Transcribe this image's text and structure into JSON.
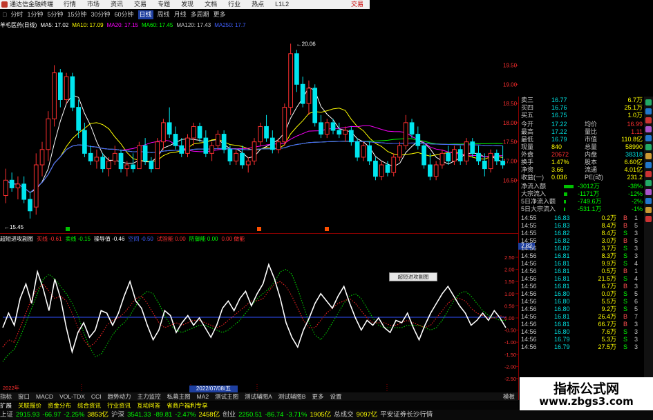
{
  "titlebar": {
    "title": "通达信金融终端",
    "menu": [
      "行情",
      "市场",
      "资讯",
      "交易",
      "专题",
      "发现",
      "文档",
      "行业",
      "热点",
      "L1L2"
    ],
    "trade_label": "交易",
    "colors": {
      "red": "#c00000"
    }
  },
  "period_bar": {
    "lead": "□",
    "items": [
      "分时",
      "1分钟",
      "5分钟",
      "15分钟",
      "30分钟",
      "60分钟",
      "日线",
      "周线",
      "月线",
      "多周期",
      "更多"
    ],
    "active_index": 6
  },
  "main_chart": {
    "stock": "羊毛医药(日线)",
    "ma": [
      {
        "label": "MA5: 17.02",
        "color": "#ffffff"
      },
      {
        "label": "MA10: 17.09",
        "color": "#ffff00"
      },
      {
        "label": "MA20: 17.15",
        "color": "#ff00ff"
      },
      {
        "label": "MA60: 17.45",
        "color": "#00ff00"
      },
      {
        "label": "MA120: 17.43",
        "color": "#c8c8c8"
      },
      {
        "label": "MA250: 17.7",
        "color": "#4060ff"
      }
    ],
    "high_label": "20.06",
    "low_label": "15.45",
    "price_axis": [
      "19.50",
      "19.00",
      "18.50",
      "18.00",
      "17.50",
      "17.00",
      "16.50"
    ],
    "candles": [
      {
        "o": 16.1,
        "h": 16.8,
        "l": 15.9,
        "c": 16.5
      },
      {
        "o": 16.5,
        "h": 16.7,
        "l": 16.2,
        "c": 16.3
      },
      {
        "o": 16.3,
        "h": 16.6,
        "l": 16.0,
        "c": 16.4
      },
      {
        "o": 16.4,
        "h": 16.6,
        "l": 15.9,
        "c": 16.0
      },
      {
        "o": 16.0,
        "h": 16.2,
        "l": 15.5,
        "c": 15.7
      },
      {
        "o": 15.8,
        "h": 17.2,
        "l": 15.6,
        "c": 16.9
      },
      {
        "o": 16.9,
        "h": 17.5,
        "l": 16.6,
        "c": 17.3
      },
      {
        "o": 17.3,
        "h": 18.3,
        "l": 17.0,
        "c": 18.1
      },
      {
        "o": 18.1,
        "h": 19.5,
        "l": 17.9,
        "c": 19.3
      },
      {
        "o": 19.3,
        "h": 19.4,
        "l": 18.4,
        "c": 18.6
      },
      {
        "o": 18.6,
        "h": 19.3,
        "l": 18.5,
        "c": 19.2
      },
      {
        "o": 19.2,
        "h": 19.3,
        "l": 18.3,
        "c": 18.4
      },
      {
        "o": 18.4,
        "h": 18.6,
        "l": 17.6,
        "c": 17.8
      },
      {
        "o": 17.8,
        "h": 18.0,
        "l": 17.1,
        "c": 17.2
      },
      {
        "o": 17.2,
        "h": 17.4,
        "l": 16.9,
        "c": 17.0
      },
      {
        "o": 17.0,
        "h": 17.3,
        "l": 16.8,
        "c": 17.1
      },
      {
        "o": 17.1,
        "h": 17.2,
        "l": 16.7,
        "c": 16.8
      },
      {
        "o": 16.8,
        "h": 17.1,
        "l": 16.6,
        "c": 17.0
      },
      {
        "o": 17.0,
        "h": 17.4,
        "l": 16.9,
        "c": 17.2
      },
      {
        "o": 17.2,
        "h": 17.3,
        "l": 16.7,
        "c": 16.8
      },
      {
        "o": 16.8,
        "h": 17.0,
        "l": 16.6,
        "c": 16.9
      },
      {
        "o": 16.9,
        "h": 17.2,
        "l": 16.7,
        "c": 16.8
      },
      {
        "o": 16.8,
        "h": 17.5,
        "l": 16.8,
        "c": 17.4
      },
      {
        "o": 17.4,
        "h": 17.6,
        "l": 16.9,
        "c": 17.0
      },
      {
        "o": 17.0,
        "h": 17.1,
        "l": 16.7,
        "c": 16.8
      },
      {
        "o": 16.8,
        "h": 17.6,
        "l": 16.8,
        "c": 17.5
      },
      {
        "o": 17.5,
        "h": 18.1,
        "l": 17.3,
        "c": 18.0
      },
      {
        "o": 18.0,
        "h": 18.4,
        "l": 17.6,
        "c": 17.7
      },
      {
        "o": 17.7,
        "h": 17.9,
        "l": 17.3,
        "c": 17.4
      },
      {
        "o": 17.4,
        "h": 17.6,
        "l": 17.1,
        "c": 17.2
      },
      {
        "o": 17.2,
        "h": 17.7,
        "l": 17.1,
        "c": 17.6
      },
      {
        "o": 17.6,
        "h": 18.0,
        "l": 17.4,
        "c": 17.9
      },
      {
        "o": 17.9,
        "h": 18.0,
        "l": 17.5,
        "c": 17.6
      },
      {
        "o": 17.6,
        "h": 17.8,
        "l": 17.1,
        "c": 17.2
      },
      {
        "o": 17.2,
        "h": 17.5,
        "l": 17.0,
        "c": 17.4
      },
      {
        "o": 17.4,
        "h": 17.8,
        "l": 17.3,
        "c": 17.7
      },
      {
        "o": 17.7,
        "h": 17.8,
        "l": 17.2,
        "c": 17.3
      },
      {
        "o": 17.3,
        "h": 17.4,
        "l": 16.9,
        "c": 17.0
      },
      {
        "o": 17.0,
        "h": 17.3,
        "l": 16.9,
        "c": 17.2
      },
      {
        "o": 17.2,
        "h": 17.4,
        "l": 16.8,
        "c": 16.9
      },
      {
        "o": 16.9,
        "h": 17.1,
        "l": 16.7,
        "c": 17.0
      },
      {
        "o": 17.0,
        "h": 17.6,
        "l": 16.9,
        "c": 17.5
      },
      {
        "o": 17.5,
        "h": 18.0,
        "l": 17.4,
        "c": 17.9
      },
      {
        "o": 17.9,
        "h": 18.2,
        "l": 17.5,
        "c": 17.6
      },
      {
        "o": 17.6,
        "h": 17.8,
        "l": 17.2,
        "c": 17.3
      },
      {
        "o": 17.3,
        "h": 17.6,
        "l": 17.2,
        "c": 17.5
      },
      {
        "o": 17.5,
        "h": 18.5,
        "l": 17.4,
        "c": 18.4
      },
      {
        "o": 18.4,
        "h": 20.06,
        "l": 18.2,
        "c": 19.8
      },
      {
        "o": 19.8,
        "h": 19.9,
        "l": 18.8,
        "c": 19.0
      },
      {
        "o": 19.0,
        "h": 19.2,
        "l": 18.4,
        "c": 18.5
      },
      {
        "o": 18.5,
        "h": 19.1,
        "l": 18.2,
        "c": 18.9
      },
      {
        "o": 18.9,
        "h": 19.0,
        "l": 17.9,
        "c": 18.0
      },
      {
        "o": 18.0,
        "h": 18.2,
        "l": 17.6,
        "c": 17.7
      },
      {
        "o": 17.7,
        "h": 18.1,
        "l": 17.6,
        "c": 18.0
      },
      {
        "o": 18.0,
        "h": 18.1,
        "l": 17.7,
        "c": 17.8
      },
      {
        "o": 17.8,
        "h": 18.0,
        "l": 17.6,
        "c": 17.7
      },
      {
        "o": 17.7,
        "h": 17.9,
        "l": 17.5,
        "c": 17.8
      },
      {
        "o": 17.8,
        "h": 17.9,
        "l": 17.4,
        "c": 17.5
      },
      {
        "o": 17.5,
        "h": 17.6,
        "l": 17.0,
        "c": 17.1
      },
      {
        "o": 17.1,
        "h": 17.5,
        "l": 17.0,
        "c": 17.4
      },
      {
        "o": 17.4,
        "h": 17.5,
        "l": 16.9,
        "c": 17.0
      },
      {
        "o": 17.0,
        "h": 17.1,
        "l": 16.5,
        "c": 16.6
      },
      {
        "o": 16.6,
        "h": 17.0,
        "l": 16.5,
        "c": 16.9
      },
      {
        "o": 16.9,
        "h": 17.0,
        "l": 16.6,
        "c": 16.7
      },
      {
        "o": 16.7,
        "h": 17.2,
        "l": 16.6,
        "c": 17.1
      },
      {
        "o": 17.1,
        "h": 17.5,
        "l": 17.0,
        "c": 17.4
      },
      {
        "o": 17.4,
        "h": 18.2,
        "l": 17.3,
        "c": 18.0
      },
      {
        "o": 18.0,
        "h": 18.1,
        "l": 17.6,
        "c": 17.7
      },
      {
        "o": 17.7,
        "h": 17.9,
        "l": 17.3,
        "c": 17.4
      },
      {
        "o": 17.4,
        "h": 17.5,
        "l": 16.8,
        "c": 16.9
      },
      {
        "o": 16.9,
        "h": 17.2,
        "l": 16.5,
        "c": 16.6
      },
      {
        "o": 16.6,
        "h": 17.0,
        "l": 16.5,
        "c": 16.9
      },
      {
        "o": 16.9,
        "h": 17.3,
        "l": 16.8,
        "c": 17.2
      },
      {
        "o": 17.2,
        "h": 17.4,
        "l": 16.9,
        "c": 17.0
      },
      {
        "o": 17.0,
        "h": 17.4,
        "l": 16.9,
        "c": 17.3
      },
      {
        "o": 17.3,
        "h": 17.4,
        "l": 16.9,
        "c": 17.0
      },
      {
        "o": 17.0,
        "h": 17.6,
        "l": 16.9,
        "c": 17.5
      },
      {
        "o": 17.5,
        "h": 17.6,
        "l": 17.1,
        "c": 17.2
      },
      {
        "o": 17.2,
        "h": 17.4,
        "l": 16.9,
        "c": 17.0
      },
      {
        "o": 17.0,
        "h": 17.2,
        "l": 16.6,
        "c": 16.8
      },
      {
        "o": 16.8,
        "h": 17.3,
        "l": 16.7,
        "c": 17.2
      },
      {
        "o": 17.2,
        "h": 17.3,
        "l": 16.9,
        "c": 17.0
      },
      {
        "o": 17.0,
        "h": 17.4,
        "l": 16.8,
        "c": 16.9
      }
    ],
    "colors": {
      "up": "#ff3030",
      "down": "#00e5ee",
      "axis": "#8b0000"
    }
  },
  "indicator": {
    "title": "超短进攻副图",
    "labels": [
      {
        "text": "买线 -0.61",
        "color": "#ff3030"
      },
      {
        "text": "卖线 -0.15",
        "color": "#00ff00"
      },
      {
        "text": "操导值 -0.46",
        "color": "#ffffff"
      },
      {
        "text": "空间 -0.50",
        "color": "#4060ff"
      },
      {
        "text": "试验能 0.00",
        "color": "#ff3030"
      },
      {
        "text": "防御能 0.00",
        "color": "#00ff00"
      },
      {
        "text": "0.00 做能",
        "color": "#ff3030"
      }
    ],
    "axis": [
      "2.50",
      "2.00",
      "1.50",
      "1.00",
      "0.50",
      "0.00",
      "-0.50",
      "-1.00",
      "-1.50",
      "-2.00",
      "-2.50"
    ],
    "last_value": "2.82",
    "popup": "超短进攻副图",
    "date_chip": "2022/07/08/五",
    "year_label": "2022年",
    "white": [
      -0.4,
      0.2,
      -0.3,
      0.8,
      1.4,
      0.6,
      1.9,
      1.2,
      0.3,
      1.6,
      0.8,
      -0.4,
      -1.4,
      -0.6,
      -0.2,
      -0.8,
      -0.5,
      0.3,
      0.2,
      -0.3,
      0.2,
      0.9,
      1.5,
      0.7,
      0.4,
      -0.3,
      -0.9,
      -0.5,
      0.3,
      0.1,
      -0.6,
      -0.2,
      0.1,
      -0.3,
      0.0,
      -0.4,
      -0.8,
      -0.3,
      0.4,
      0.7,
      0.3,
      0.8,
      1.1,
      0.5,
      1.0,
      1.4,
      2.2,
      1.6,
      0.8,
      -0.2,
      -0.8,
      -1.2,
      -0.5,
      0.0,
      0.6,
      1.0,
      0.7,
      0.4,
      0.9,
      1.3,
      0.6,
      0.0,
      -0.5,
      -0.1,
      -0.3,
      0.0,
      -0.4,
      -0.6,
      -0.1,
      -0.2,
      0.2,
      -0.4,
      -0.9,
      -0.3,
      0.2,
      0.6,
      1.0,
      1.3,
      0.9,
      0.5,
      0.2,
      -0.3,
      -0.1,
      0.2,
      -0.1,
      0.3,
      0.0,
      -0.4
    ],
    "red": [
      -1.2,
      -0.9,
      -1.0,
      -0.4,
      0.2,
      0.8,
      1.2,
      1.4,
      1.1,
      0.8,
      0.9,
      0.7,
      0.2,
      -0.4,
      -0.9,
      -1.2,
      -1.0,
      -0.7,
      -0.3,
      -0.1,
      0.0,
      0.2,
      0.5,
      0.8,
      0.9,
      0.6,
      0.2,
      -0.2,
      -0.4,
      -0.3,
      -0.2,
      -0.3,
      -0.2,
      -0.1,
      -0.1,
      -0.2,
      -0.3,
      -0.4,
      -0.3,
      -0.1,
      0.1,
      0.3,
      0.5,
      0.7,
      0.7,
      0.8,
      1.1,
      1.4,
      1.5,
      1.3,
      0.9,
      0.4,
      -0.1,
      -0.4,
      -0.4,
      -0.1,
      0.2,
      0.4,
      0.6,
      0.7,
      0.8,
      0.6,
      0.3,
      0.0,
      -0.2,
      -0.2,
      -0.2,
      -0.3,
      -0.3,
      -0.2,
      -0.1,
      -0.2,
      -0.3,
      -0.4,
      -0.3,
      0.0,
      0.3,
      0.6,
      0.8,
      0.8,
      0.7,
      0.4,
      0.2,
      0.1,
      0.0,
      0.0,
      0.1,
      0.0
    ],
    "green": [
      -1.8,
      -1.5,
      -1.3,
      -0.8,
      -0.2,
      0.4,
      1.0,
      1.6,
      1.8,
      1.6,
      1.3,
      1.0,
      0.6,
      0.1,
      -0.6,
      -1.2,
      -1.6,
      -1.5,
      -1.1,
      -0.7,
      -0.4,
      -0.2,
      0.1,
      0.5,
      0.9,
      1.1,
      1.0,
      0.6,
      0.1,
      -0.3,
      -0.5,
      -0.6,
      -0.5,
      -0.4,
      -0.3,
      -0.3,
      -0.4,
      -0.5,
      -0.6,
      -0.5,
      -0.3,
      -0.1,
      0.2,
      0.5,
      0.8,
      1.0,
      1.2,
      1.5,
      1.9,
      2.0,
      1.8,
      1.2,
      0.5,
      -0.2,
      -0.7,
      -0.9,
      -0.6,
      -0.2,
      0.2,
      0.6,
      0.9,
      1.0,
      0.8,
      0.4,
      0.0,
      -0.3,
      -0.4,
      -0.4,
      -0.4,
      -0.4,
      -0.3,
      -0.3,
      -0.3,
      -0.4,
      -0.5,
      -0.4,
      -0.1,
      0.3,
      0.7,
      1.0,
      1.1,
      0.9,
      0.6,
      0.3,
      0.1,
      0.0,
      -0.1,
      -0.1
    ]
  },
  "quote": {
    "book": [
      {
        "k": "卖三",
        "v": "16.77",
        "n": "6.7万",
        "vc": "#ffff00"
      },
      {
        "k": "买四",
        "v": "16.76",
        "n": "25.1万",
        "vc": "#ffff00"
      },
      {
        "k": "买五",
        "v": "16.75",
        "n": "1.0万",
        "vc": "#ffff00"
      }
    ],
    "stats": [
      [
        "今开",
        "17.22",
        "均价",
        "16.99"
      ],
      [
        "最高",
        "17.22",
        "量比",
        "1.11"
      ],
      [
        "最低",
        "16.79",
        "市值",
        "110.8亿"
      ],
      [
        "现量",
        "840",
        "总量",
        "58990"
      ],
      [
        "外盘",
        "20672",
        "内盘",
        "38318"
      ],
      [
        "换手",
        "1.47%",
        "股本",
        "6.60亿"
      ],
      [
        "净资",
        "3.66",
        "流通",
        "4.01亿"
      ],
      [
        "收益(一)",
        "0.036",
        "PE(动)",
        "231.2"
      ]
    ],
    "flows": [
      {
        "k": "净流入额",
        "v": "-3012万",
        "p": "-38%"
      },
      {
        "k": "大宗流入",
        "v": "-1171万",
        "p": "-12%"
      },
      {
        "k": "5日净流入额",
        "v": "-749.6万",
        "p": "-2%"
      },
      {
        "k": "5日大宗流入",
        "v": "-531.1万",
        "p": "-1%"
      }
    ],
    "trades": [
      [
        "14:55",
        "16.83",
        "0.2万",
        "B",
        "1"
      ],
      [
        "14:55",
        "16.83",
        "8.4万",
        "B",
        "5"
      ],
      [
        "14:55",
        "16.82",
        "8.4万",
        "S",
        "3"
      ],
      [
        "14:55",
        "16.82",
        "3.0万",
        "B",
        "5"
      ],
      [
        "14:56",
        "16.82",
        "3.7万",
        "S",
        "3"
      ],
      [
        "14:56",
        "16.81",
        "8.3万",
        "S",
        "3"
      ],
      [
        "14:56",
        "16.81",
        "9.9万",
        "S",
        "4"
      ],
      [
        "14:56",
        "16.81",
        "0.5万",
        "B",
        "1"
      ],
      [
        "14:56",
        "16.81",
        "21.5万",
        "S",
        "4"
      ],
      [
        "14:56",
        "16.81",
        "6.7万",
        "B",
        "3"
      ],
      [
        "14:56",
        "16.80",
        "0.0万",
        "S",
        "5"
      ],
      [
        "14:56",
        "16.80",
        "5.5万",
        "S",
        "6"
      ],
      [
        "14:56",
        "16.80",
        "9.2万",
        "S",
        "5"
      ],
      [
        "14:56",
        "16.81",
        "26.4万",
        "B",
        "7"
      ],
      [
        "14:56",
        "16.81",
        "66.7万",
        "B",
        "3"
      ],
      [
        "14:56",
        "16.80",
        "7.6万",
        "S",
        "3"
      ],
      [
        "14:56",
        "16.79",
        "5.3万",
        "S",
        "3"
      ],
      [
        "14:56",
        "16.79",
        "27.5万",
        "S",
        "3"
      ]
    ]
  },
  "tabs": [
    "指标",
    "窗口",
    "MACD",
    "VOL-TDX",
    "CCI",
    "趋势动力",
    "主力监控",
    "私募主图",
    "MA2",
    "测试主图",
    "测试辅图A",
    "测试辅图B",
    "更多",
    "设置"
  ],
  "tabs_right": "模板",
  "tabs_extra": [
    "扩展",
    "关联报价",
    "资金分布",
    "综合资讯",
    "行业资讯",
    "互动问答",
    "省商户福利专享"
  ],
  "status": [
    {
      "t": "上证",
      "c": "#c8c8c8"
    },
    {
      "t": "2915.93",
      "c": "#00ff00"
    },
    {
      "t": "-66.97",
      "c": "#00ff00"
    },
    {
      "t": "-2.25%",
      "c": "#00ff00"
    },
    {
      "t": "3853亿",
      "c": "#ffff00"
    },
    {
      "t": "沪深",
      "c": "#c8c8c8"
    },
    {
      "t": "3541.33",
      "c": "#00ff00"
    },
    {
      "t": "-89.81",
      "c": "#00ff00"
    },
    {
      "t": "-2.47%",
      "c": "#00ff00"
    },
    {
      "t": "2458亿",
      "c": "#ffff00"
    },
    {
      "t": "创业",
      "c": "#c8c8c8"
    },
    {
      "t": "2250.51",
      "c": "#00ff00"
    },
    {
      "t": "-86.74",
      "c": "#00ff00"
    },
    {
      "t": "-3.71%",
      "c": "#00ff00"
    },
    {
      "t": "1905亿",
      "c": "#ffff00"
    },
    {
      "t": "总成交",
      "c": "#c8c8c8"
    },
    {
      "t": "9097亿",
      "c": "#ffff00"
    },
    {
      "t": "平安证券长沙行情",
      "c": "#c8c8c8"
    }
  ],
  "brand": {
    "name": "指标公式网",
    "url": "www.zbgs3.com"
  }
}
